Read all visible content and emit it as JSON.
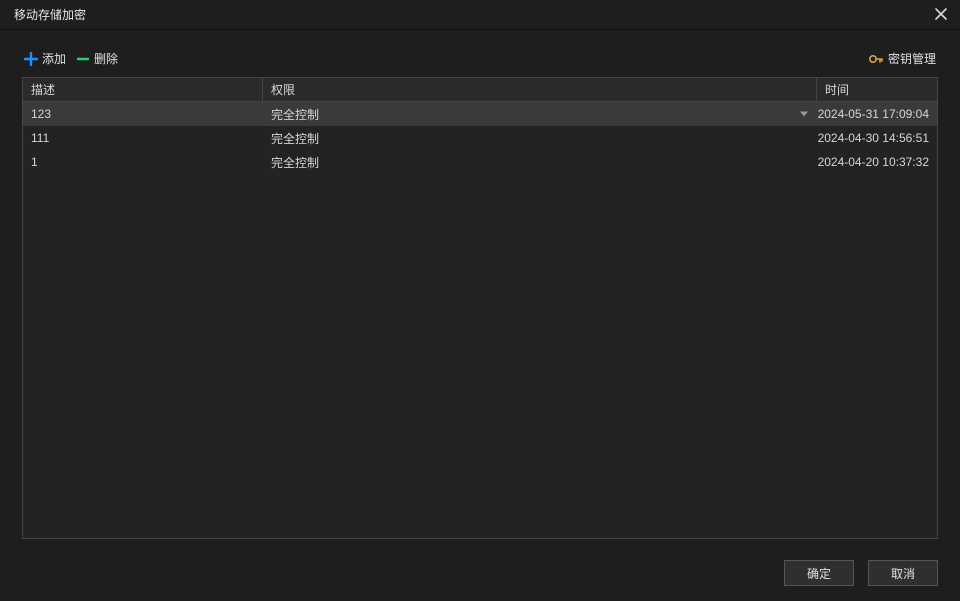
{
  "window": {
    "title": "移动存储加密"
  },
  "toolbar": {
    "add_label": "添加",
    "delete_label": "删除",
    "key_mgmt_label": "密钥管理"
  },
  "table": {
    "headers": {
      "desc": "描述",
      "perm": "权限",
      "time": "时间"
    },
    "rows": [
      {
        "desc": "123",
        "perm": "完全控制",
        "time": "2024-05-31 17:09:04",
        "selected": true
      },
      {
        "desc": "111",
        "perm": "完全控制",
        "time": "2024-04-30 14:56:51",
        "selected": false
      },
      {
        "desc": "1",
        "perm": "完全控制",
        "time": "2024-04-20 10:37:32",
        "selected": false
      }
    ]
  },
  "footer": {
    "ok_label": "确定",
    "cancel_label": "取消"
  },
  "colors": {
    "accent_blue": "#1f8fff",
    "accent_green": "#2ecc71",
    "key_gold": "#d9a441",
    "bg": "#1e1e1e"
  }
}
